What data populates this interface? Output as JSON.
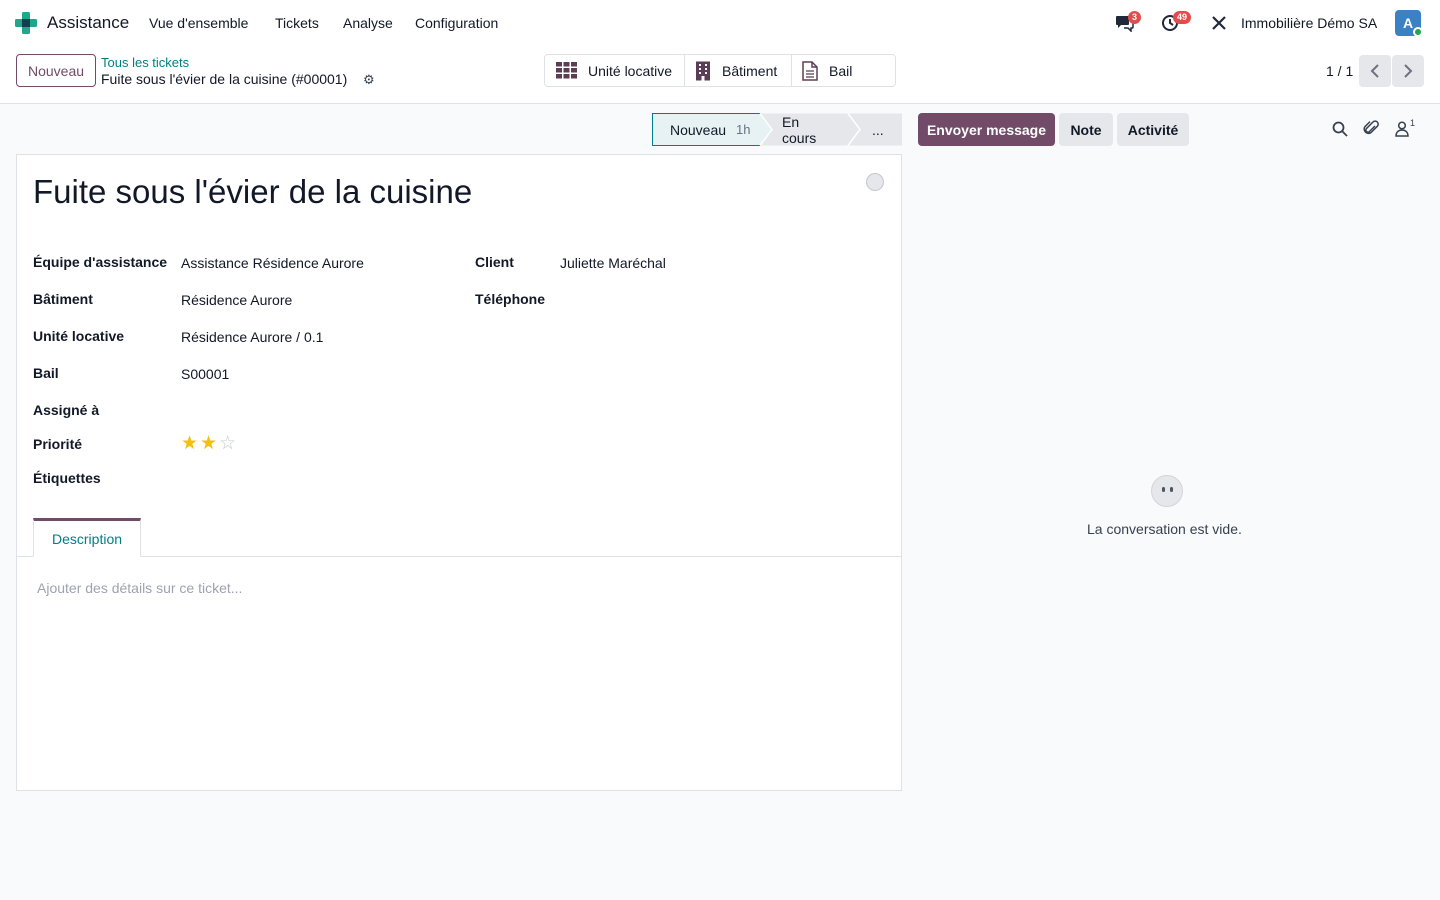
{
  "navbar": {
    "app_name": "Assistance",
    "menu": [
      "Vue d'ensemble",
      "Tickets",
      "Analyse",
      "Configuration"
    ],
    "messages_count": "3",
    "activities_count": "49",
    "company": "Immobilière Démo SA",
    "avatar_letter": "A",
    "brand_color": "#714b67",
    "accent_color": "#017e84"
  },
  "control": {
    "new_button": "Nouveau",
    "breadcrumb_parent": "Tous les tickets",
    "breadcrumb_current": "Fuite sous l'évier de la cuisine (#00001)",
    "smart_buttons": [
      {
        "label": "Unité locative",
        "icon": "grid-icon"
      },
      {
        "label": "Bâtiment",
        "icon": "building-icon"
      },
      {
        "label": "Bail",
        "icon": "document-icon"
      }
    ],
    "pager": "1 / 1"
  },
  "statusbar": {
    "stages": [
      {
        "label": "Nouveau",
        "duration": "1h",
        "active": true
      },
      {
        "label": "En cours",
        "duration": "",
        "active": false
      },
      {
        "label": "...",
        "duration": "",
        "active": false
      }
    ]
  },
  "chatter": {
    "send_message": "Envoyer message",
    "note": "Note",
    "activity": "Activité",
    "followers_count": "1",
    "empty_text": "La conversation est vide."
  },
  "form": {
    "title": "Fuite sous l'évier de la cuisine",
    "left_fields": [
      {
        "label": "Équipe d'assistance",
        "value": "Assistance Résidence Aurore"
      },
      {
        "label": "Bâtiment",
        "value": "Résidence Aurore"
      },
      {
        "label": "Unité locative",
        "value": "Résidence Aurore / 0.1"
      },
      {
        "label": "Bail",
        "value": "S00001"
      },
      {
        "label": "Assigné à",
        "value": ""
      },
      {
        "label": "Priorité",
        "value": ""
      },
      {
        "label": "Étiquettes",
        "value": ""
      }
    ],
    "right_fields": [
      {
        "label": "Client",
        "value": "Juliette Maréchal"
      },
      {
        "label": "Téléphone",
        "value": ""
      }
    ],
    "priority_stars": 2,
    "priority_max": 3,
    "tab_label": "Description",
    "description_placeholder": "Ajouter des détails sur ce ticket..."
  }
}
